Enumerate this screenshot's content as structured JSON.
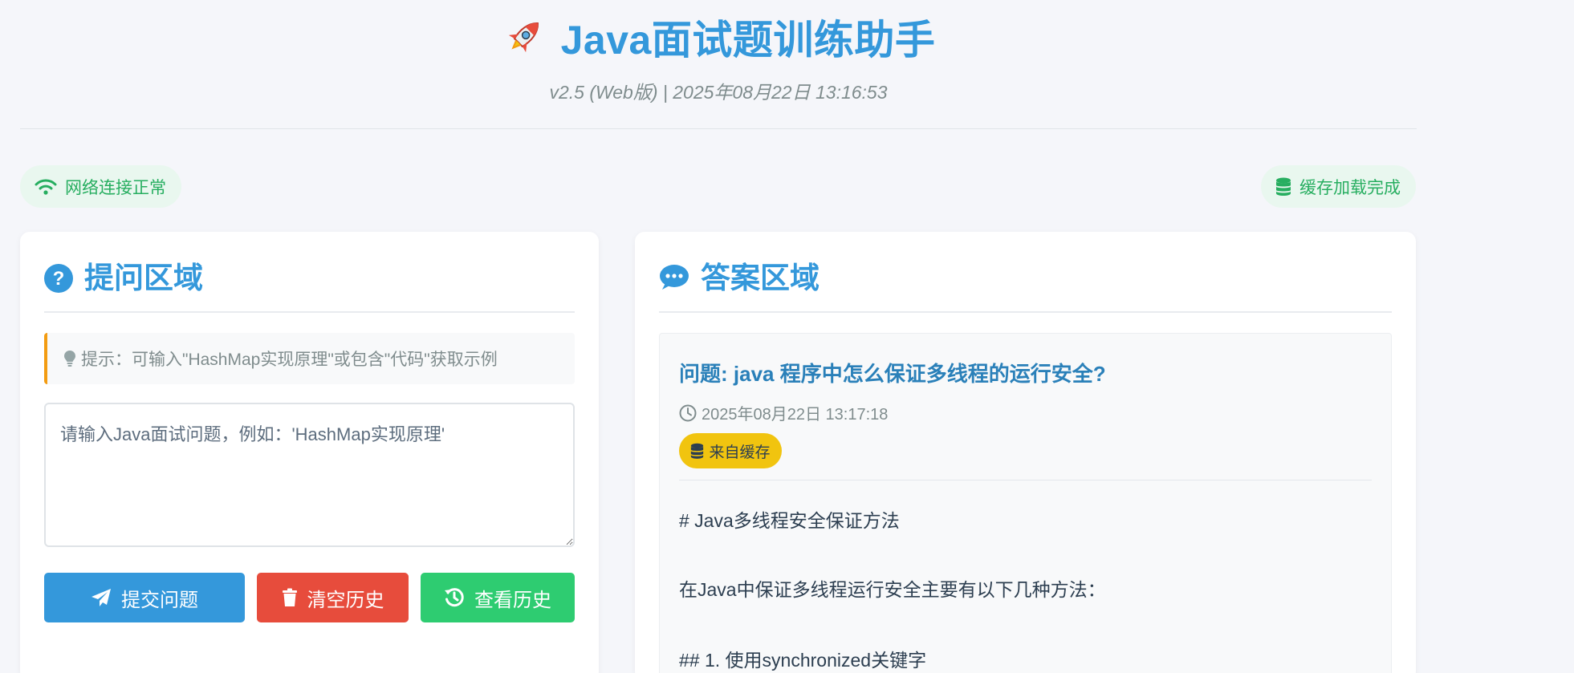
{
  "header": {
    "title": "Java面试题训练助手",
    "subtitle": "v2.5 (Web版) | 2025年08月22日 13:16:53"
  },
  "status": {
    "network": "网络连接正常",
    "cache": "缓存加载完成"
  },
  "question_panel": {
    "title": "提问区域",
    "tip": "提示：可输入\"HashMap实现原理\"或包含\"代码\"获取示例",
    "input_placeholder": "请输入Java面试问题，例如：'HashMap实现原理'",
    "input_value": "",
    "buttons": {
      "submit": "提交问题",
      "clear": "清空历史",
      "history": "查看历史"
    }
  },
  "answer_panel": {
    "title": "答案区域",
    "question": "问题: java 程序中怎么保证多线程的运行安全?",
    "timestamp": "2025年08月22日 13:17:18",
    "badge": "来自缓存",
    "lines": [
      "# Java多线程安全保证方法",
      "在Java中保证多线程运行安全主要有以下几种方法：",
      "## 1. 使用synchronized关键字"
    ]
  },
  "colors": {
    "primary": "#3498db",
    "danger": "#e74c3c",
    "success": "#2ecc71",
    "status_text": "#27ae60",
    "warning": "#f39c12",
    "badge": "#f1c40f"
  },
  "icons": {
    "title": "rocket-icon",
    "network": "wifi-icon",
    "cache": "database-icon",
    "question_panel": "question-circle-icon",
    "answer_panel": "comment-icon",
    "tip": "lightbulb-icon",
    "submit": "paper-plane-icon",
    "clear": "trash-icon",
    "history": "history-icon",
    "timestamp": "clock-icon",
    "badge": "database-icon"
  }
}
